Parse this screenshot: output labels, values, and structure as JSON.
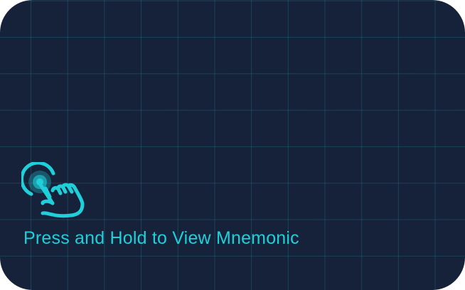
{
  "reveal_card": {
    "label": "Press and Hold to View Mnemonic",
    "icon": "press-and-hold-hand-icon",
    "colors": {
      "background": "#16223a",
      "grid": "#1e96a0",
      "accent": "#1fcfda"
    }
  }
}
